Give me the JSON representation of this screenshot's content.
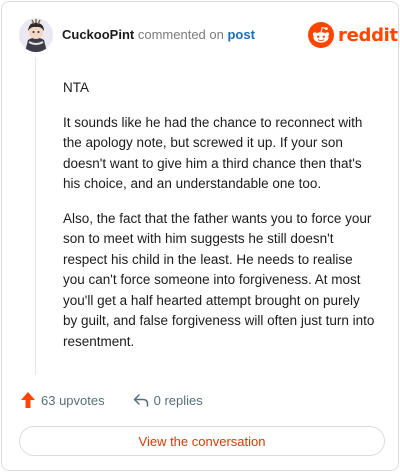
{
  "header": {
    "username": "CuckooPint",
    "action_text": "commented on",
    "target_link": "post",
    "brand": "reddit",
    "avatar_icon": "user-avatar",
    "logo_icon": "reddit-snoo-icon",
    "brand_color": "#ff4500"
  },
  "comment": {
    "paragraphs": [
      "NTA",
      "It sounds like he had the chance to reconnect with the apology note, but screwed it up. If your son doesn't want to give him a third chance then that's his choice, and an understandable one too.",
      "Also, the fact that the father wants you to force your son to meet with him suggests he still doesn't respect his child in the least. He needs to realise you can't force someone into forgiveness. At most you'll get a half hearted attempt brought on purely by guilt, and false forgiveness will often just turn into resentment."
    ]
  },
  "actions": {
    "upvotes": "63 upvotes",
    "replies": "0 replies",
    "upvote_icon": "upvote-arrow-icon",
    "reply_icon": "reply-arrow-icon"
  },
  "cta": {
    "label": "View the conversation",
    "color": "#d93a00"
  }
}
